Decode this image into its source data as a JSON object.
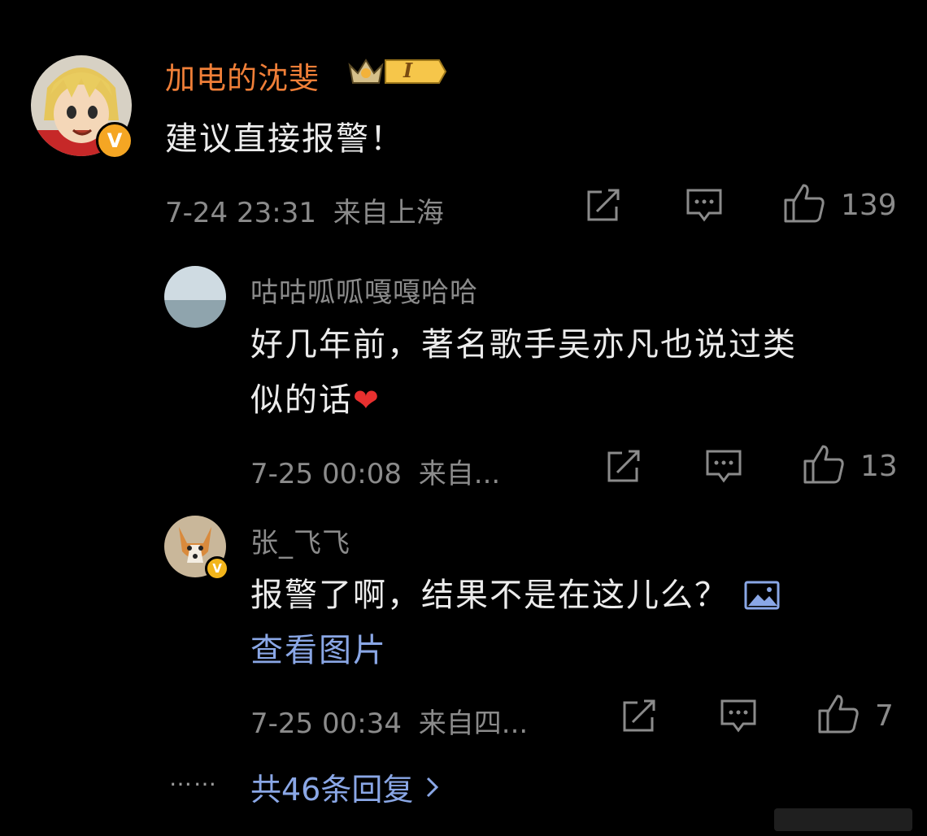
{
  "comment": {
    "author": "加电的沈斐",
    "rank_badge": "I",
    "text": "建议直接报警！",
    "time": "7-24 23:31",
    "location": "来自上海",
    "likes": "139",
    "verified_label": "V"
  },
  "replies": [
    {
      "author": "咕咕呱呱嘎嘎哈哈",
      "text_line1": "好几年前，著名歌手吴亦凡也说过类",
      "text_line2": "似的话",
      "emoji": "❤",
      "time": "7-25 00:08",
      "location": "来自...",
      "likes": "13"
    },
    {
      "author": "张_飞飞",
      "text_line1": "报警了啊，结果不是在这儿么？",
      "link_text": "查看图片",
      "time": "7-25 00:34",
      "location": "来自四...",
      "likes": "7",
      "verified_label": "V"
    }
  ],
  "footer": {
    "ellipsis": "……",
    "total_replies": "共46条回复"
  },
  "colors": {
    "background": "#000000",
    "author_orange": "#f07f38",
    "meta_gray": "#8b8b8b",
    "link_blue": "#8aa7e6",
    "verified_orange": "#f5a623",
    "heart_red": "#e8302f"
  }
}
